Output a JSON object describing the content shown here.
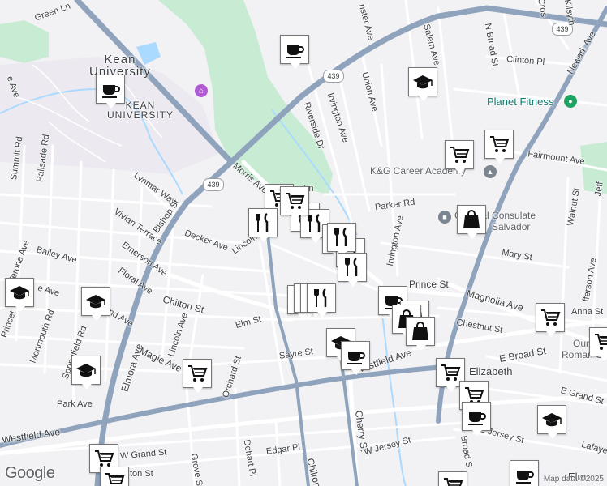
{
  "map": {
    "roads": {
      "green_ln": "Green Ln",
      "westminster_ave": "nster Ave",
      "salem_ave": "Salem Ave",
      "n_broad_st": "N Broad St",
      "newark_ave": "Newark Ave",
      "crossway": "Cros",
      "kilsyth": "Kilsyth",
      "clinton_pl": "Clinton Pl",
      "union_ave": "Union Ave",
      "irvington_ave_top": "Irvington Ave",
      "riverside_dr": "Riverside Dr",
      "fairmount_ave": "Fairmount Ave",
      "summit_rd": "Summit Rd",
      "palisade_rd": "Palisade Rd",
      "lynmar_way": "Lynmar Way",
      "morris_ave": "Morris Ave",
      "rivers_ln": "rs Ln",
      "parker_rd": "Parker Rd",
      "vivian_terrace": "Vivian Terrace",
      "bishop_st": "Bishop St",
      "decker_ave": "Decker Ave",
      "lincoln_ave_n": "Lincoln Av",
      "irvington_ave": "Irvington Ave",
      "bailey_ave": "Bailey Ave",
      "verona_ave": "Verona Ave",
      "emerson_ave": "Emerson Ave",
      "floral_ave": "Floral Ave",
      "prince_st": "Prince St",
      "magnolia_ave": "Magnolia Ave",
      "anna_st": "Anna St",
      "mary_st": "Mary St",
      "walnut_st": "Walnut St",
      "jefferson_ave": "fferson Ave",
      "jeff_edge": "Jeff",
      "chilton_st": "Chilton St",
      "elm_st": "Elm St",
      "chestnut_st": "Chestnut St",
      "e_broad_st": "E Broad St",
      "princeton_rd": "Princet",
      "monmouth_rd": "Monmouth Rd",
      "springfield_rd": "Springfield Rd",
      "grand_ave": "and Ave",
      "elmora_ave": "Elmora Ave",
      "magie_ave": "Magie Ave",
      "lincoln_ave_s": "Lincoln Ave",
      "orchard_st": "Orchard St",
      "sayre_st": "Sayre St",
      "westfield_ave_e": "Westfield Ave",
      "elizabeth": "Elizabeth",
      "e_grand_st": "E Grand St",
      "park_ave": "Park Ave",
      "westfield_ave_w": "Westfield Ave",
      "cherry_st": "Cherry St",
      "w_jersey_st": "W Jersey St",
      "e_jersey_st": "E Jersey St",
      "broad_s": "Broad S",
      "lafayette": "Lafaye",
      "w_grand_st": "W Grand St",
      "grove_st": "Grove St",
      "dehart_pl": "Dehart Pl",
      "edgar_pl": "Edgar Pl",
      "chilton_s": "Chilton",
      "elm_bottom": "Elm",
      "ave_left": "e Ave",
      "ave_left2": "e Ave",
      "ton_st": "ton St"
    },
    "shields": [
      "439",
      "439",
      "439"
    ],
    "places": {
      "kean_university": "Kean\nUniversity",
      "kean_campus": "KEAN\nUNIVERSITY",
      "planet_fitness": "Planet Fitness",
      "kg_career": "K&G Career Academy",
      "consulate_line1": "General Consulate",
      "consulate_line2": "Salvador",
      "our_lady_1": "Our La",
      "our_lady_2": "Roman Cath"
    },
    "markers": [
      {
        "type": "coffee"
      },
      {
        "type": "coffee"
      },
      {
        "type": "school"
      },
      {
        "type": "cart"
      },
      {
        "type": "cart"
      },
      {
        "type": "cart"
      },
      {
        "type": "restaurant"
      },
      {
        "type": "school"
      },
      {
        "type": "restaurant"
      },
      {
        "type": "restaurant"
      },
      {
        "type": "restaurant"
      },
      {
        "type": "restaurant"
      },
      {
        "type": "restaurant"
      },
      {
        "type": "bag"
      },
      {
        "type": "school"
      },
      {
        "type": "school"
      },
      {
        "type": "restaurant"
      },
      {
        "type": "restaurant"
      },
      {
        "type": "restaurant"
      },
      {
        "type": "restaurant"
      },
      {
        "type": "coffee"
      },
      {
        "type": "bag"
      },
      {
        "type": "bag"
      },
      {
        "type": "bag"
      },
      {
        "type": "school"
      },
      {
        "type": "coffee"
      },
      {
        "type": "cart"
      },
      {
        "type": "cart"
      },
      {
        "type": "cart"
      },
      {
        "type": "cart"
      },
      {
        "type": "coffee"
      },
      {
        "type": "school"
      },
      {
        "type": "cart"
      },
      {
        "type": "cart"
      },
      {
        "type": "cart"
      },
      {
        "type": "school"
      },
      {
        "type": "cart"
      },
      {
        "type": "coffee"
      },
      {
        "type": "cart"
      }
    ],
    "attribution": "Map data ©2025",
    "logo": "Google",
    "colors": {
      "background": "#f2f1f4",
      "park": "#c8ecd3",
      "highway": "#8fa3bd",
      "water": "#aadaff",
      "marker_border": "#777777"
    }
  }
}
